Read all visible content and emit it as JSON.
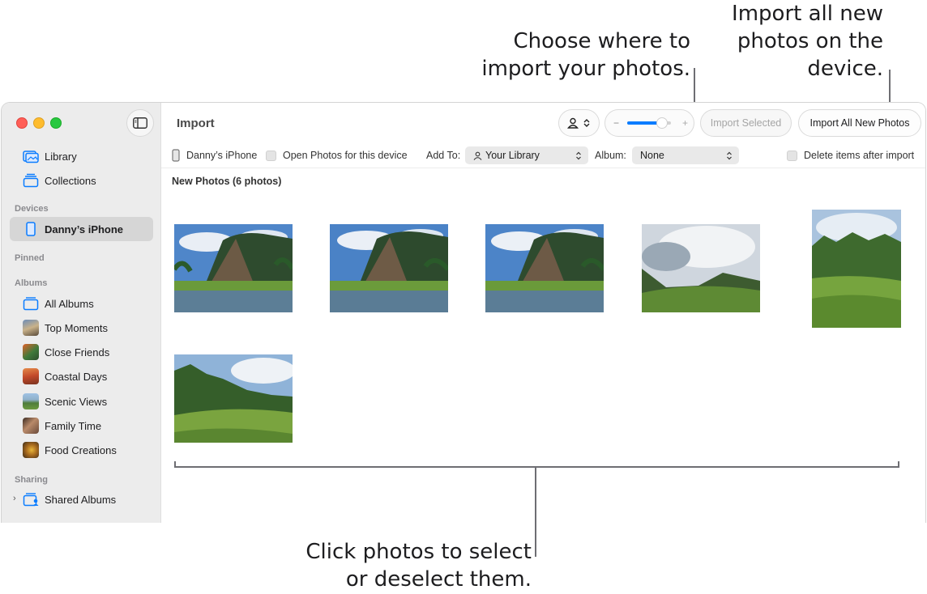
{
  "callouts": {
    "import_all": "Import all new\nphotos on the\ndevice.",
    "choose_where": "Choose where to\nimport your photos.",
    "click_photos": "Click photos to select\nor deselect them."
  },
  "sidebar": {
    "items_top": [
      {
        "label": "Library",
        "icon": "library-icon"
      },
      {
        "label": "Collections",
        "icon": "collections-icon"
      }
    ],
    "devices_heading": "Devices",
    "device": {
      "label": "Danny’s iPhone",
      "icon": "iphone-icon",
      "selected": true
    },
    "pinned_heading": "Pinned",
    "albums_heading": "Albums",
    "albums": [
      {
        "label": "All Albums",
        "icon": "albums-icon"
      },
      {
        "label": "Top Moments",
        "icon": "album-thumbnail"
      },
      {
        "label": "Close Friends",
        "icon": "album-thumbnail"
      },
      {
        "label": "Coastal Days",
        "icon": "album-thumbnail"
      },
      {
        "label": "Scenic Views",
        "icon": "album-thumbnail"
      },
      {
        "label": "Family Time",
        "icon": "album-thumbnail"
      },
      {
        "label": "Food Creations",
        "icon": "album-thumbnail"
      }
    ],
    "sharing_heading": "Sharing",
    "shared": {
      "label": "Shared Albums",
      "icon": "shared-albums-icon"
    }
  },
  "toolbar": {
    "title": "Import",
    "import_selected": "Import Selected",
    "import_all": "Import All New Photos"
  },
  "import_bar": {
    "device_name": "Danny’s iPhone",
    "open_photos_label": "Open Photos for this device",
    "add_to_label": "Add To:",
    "add_to_value": "Your Library",
    "album_label": "Album:",
    "album_value": "None",
    "delete_label": "Delete items after import"
  },
  "content": {
    "section_title": "New Photos (6 photos)",
    "photo_count": 6
  },
  "colors": {
    "accent": "#0a7cff",
    "sidebar_bg": "#ececec",
    "selected_bg": "#d6d6d6"
  }
}
